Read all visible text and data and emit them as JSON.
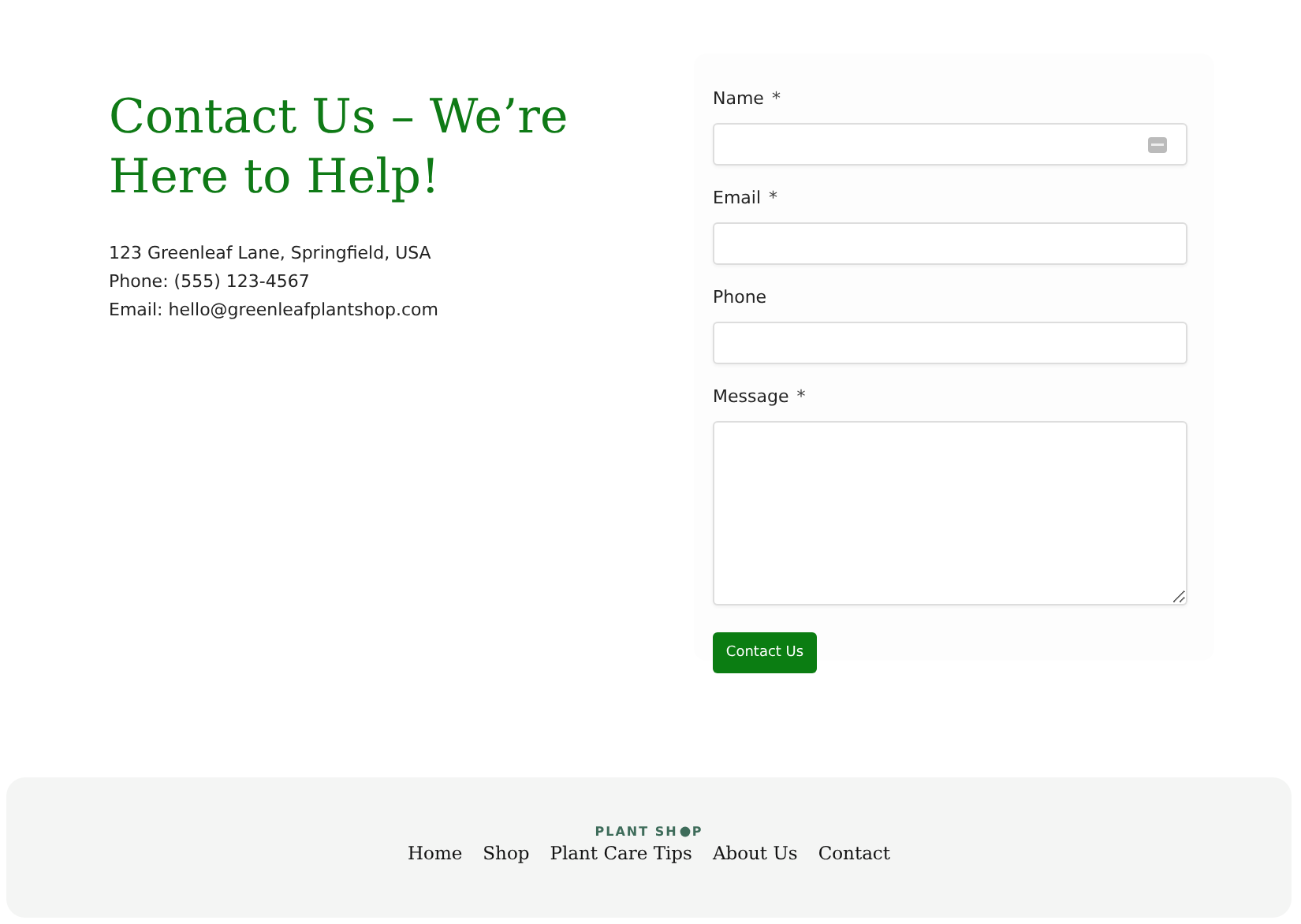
{
  "heading": "Contact Us – We’re Here to Help!",
  "contact_lines": [
    "123 Greenleaf Lane, Springfield, USA",
    "Phone: (555) 123-4567",
    "Email: hello@greenleafplantshop.com"
  ],
  "form": {
    "fields": [
      {
        "label": "Name",
        "required": true,
        "kind": "input",
        "autofill_icon": true
      },
      {
        "label": "Email",
        "required": true,
        "kind": "input",
        "autofill_icon": false
      },
      {
        "label": "Phone",
        "required": false,
        "kind": "input",
        "autofill_icon": false
      },
      {
        "label": "Message",
        "required": true,
        "kind": "textarea"
      }
    ],
    "required_mark": "*",
    "submit": "Contact Us"
  },
  "footer": {
    "logo": {
      "before": "PLANT SH",
      "after": "P"
    },
    "links": [
      "Home",
      "Shop",
      "Plant Care Tips",
      "About Us",
      "Contact"
    ]
  }
}
